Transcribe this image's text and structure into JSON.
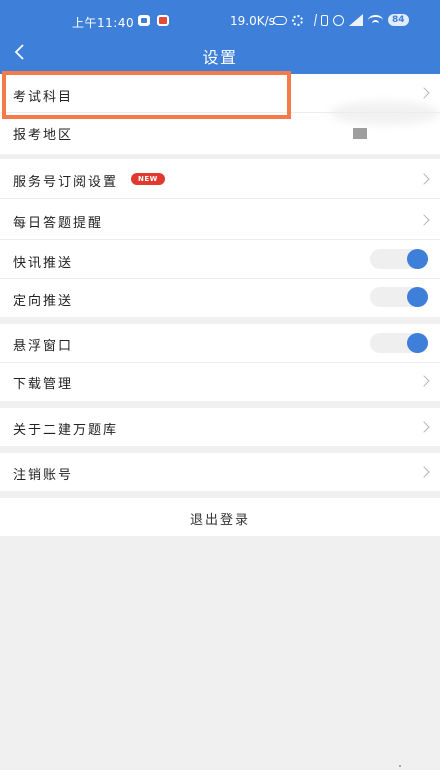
{
  "status_bar": {
    "time": "上午11:40",
    "network_speed": "19.0K/s",
    "battery": "84",
    "icons": [
      "app-notification-icon",
      "app-alert-icon",
      "cloud-icon",
      "gear-icon",
      "bluetooth-icon",
      "vibrate-icon",
      "alarm-icon",
      "signal-icon",
      "wifi-icon",
      "battery-icon"
    ]
  },
  "header": {
    "title": "设置",
    "back_icon": "chevron-left-icon"
  },
  "sections": {
    "exam_subject": "考试科目",
    "exam_region": "报考地区",
    "service_subscription": "服务号订阅设置",
    "new_badge": "NEW",
    "daily_reminder": "每日答题提醒",
    "news_push": "快讯推送",
    "targeted_push": "定向推送",
    "floating_window": "悬浮窗口",
    "download_manager": "下载管理",
    "about": "关于二建万题库",
    "deactivate_account": "注销账号"
  },
  "toggles": {
    "news_push_on": true,
    "targeted_push_on": true,
    "floating_window_on": true
  },
  "logout": {
    "label": "退出登录"
  },
  "colors": {
    "header_bg": "#3d7fd9",
    "toggle_on": "#3d7fd9",
    "highlight": "#f47b48",
    "badge_bg": "#e03a2f",
    "page_bg": "#f0f0f0"
  }
}
